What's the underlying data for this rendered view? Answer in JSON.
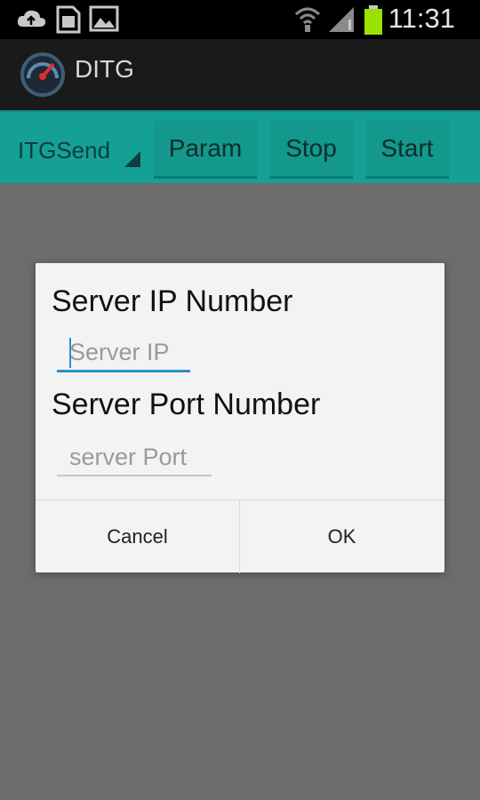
{
  "status_bar": {
    "time": "11:31",
    "icons": [
      "cloud-upload-icon",
      "sim-card-icon",
      "image-icon",
      "wifi-icon",
      "signal-icon",
      "battery-icon"
    ]
  },
  "app": {
    "title": "DITG",
    "logo": "speedometer-logo"
  },
  "toolbar": {
    "spinner_value": "ITGSend",
    "buttons": [
      "Param",
      "Stop",
      "Start"
    ]
  },
  "dialog": {
    "ip_label": "Server IP Number",
    "ip_placeholder": "Server IP",
    "port_label": "Server Port Number",
    "port_placeholder": "server Port",
    "cancel_label": "Cancel",
    "ok_label": "OK"
  },
  "colors": {
    "toolbar": "#14a096",
    "accent": "#2a8fd1",
    "battery": "#9ae000"
  }
}
